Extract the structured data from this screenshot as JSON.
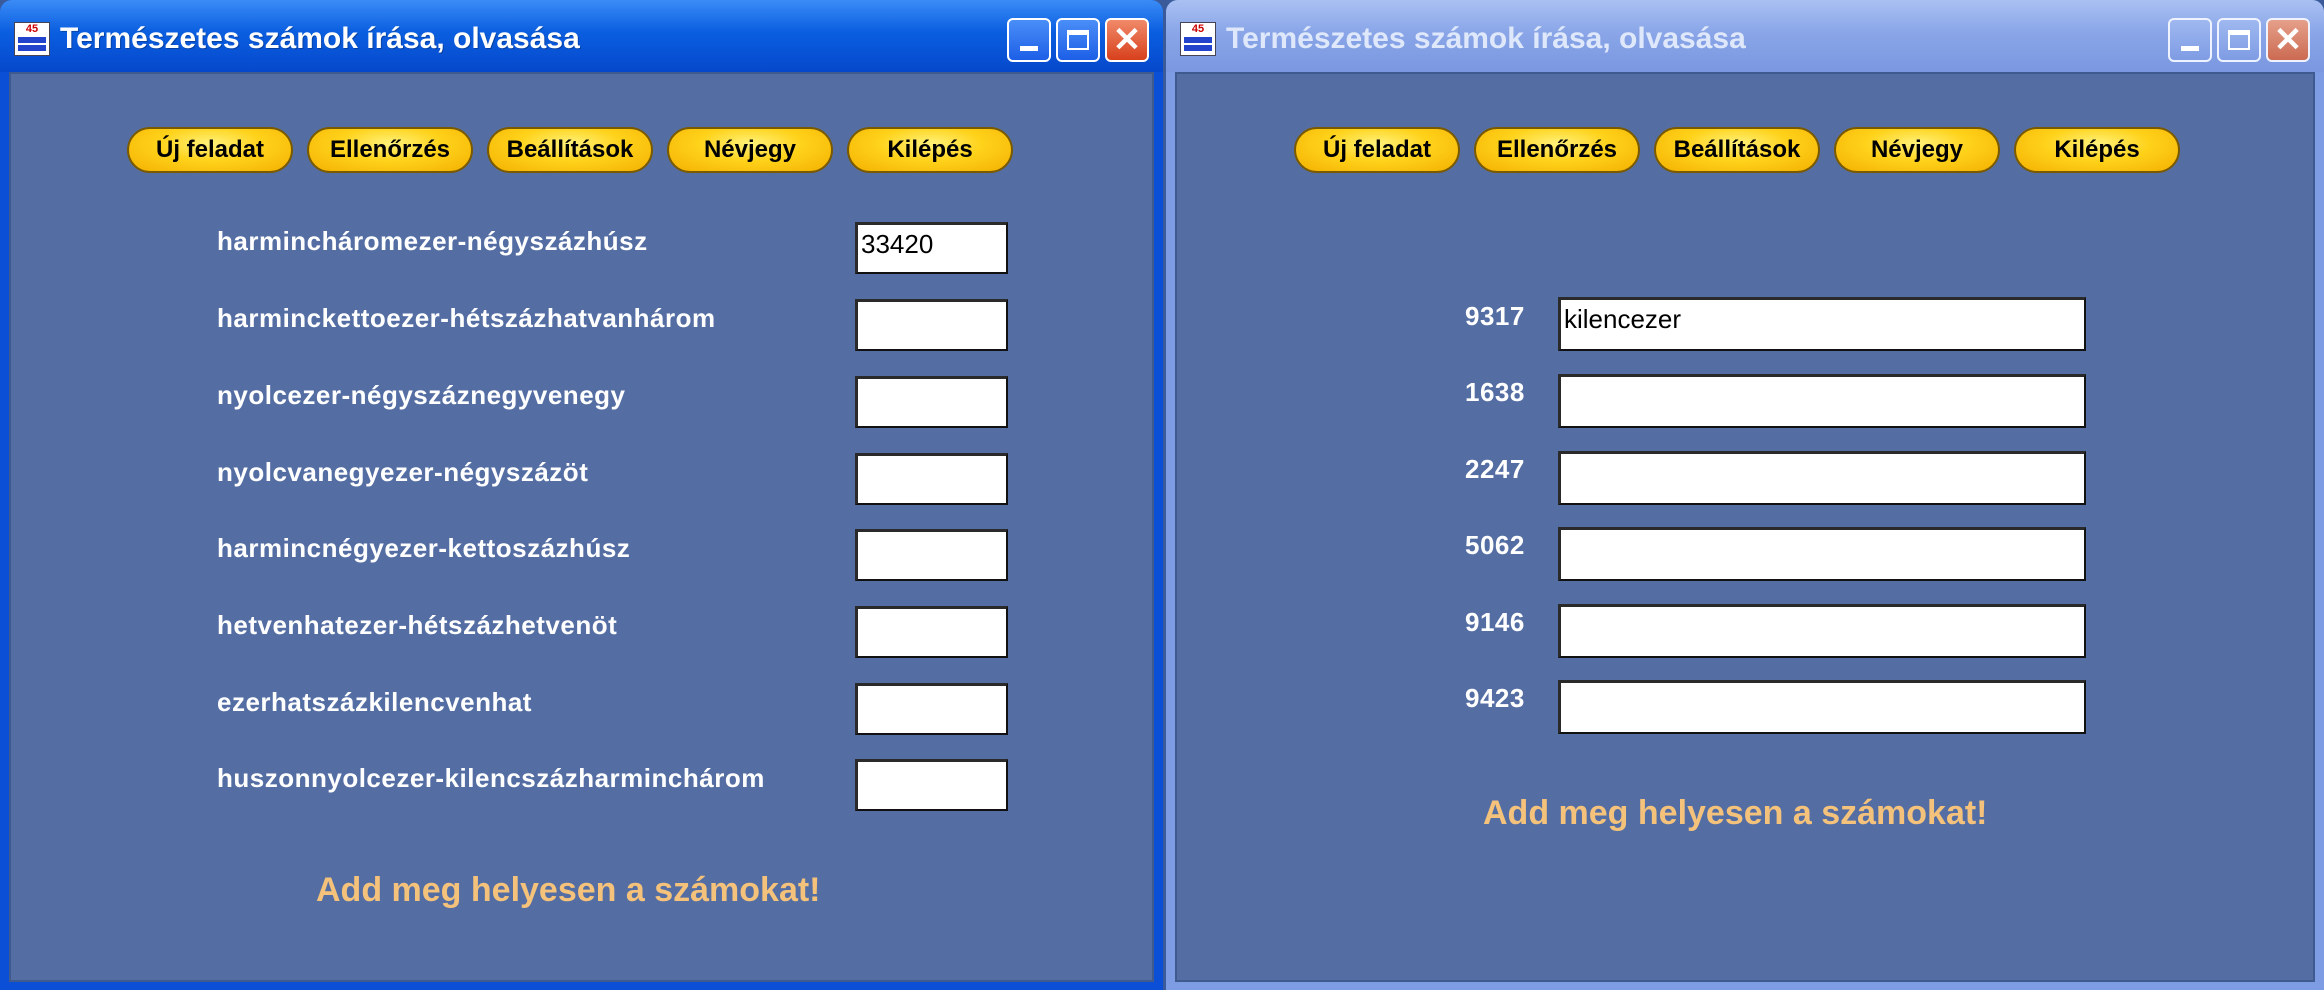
{
  "windows": [
    {
      "title": "Természetes számok írása, olvasása",
      "active": true,
      "buttons": [
        "Új feladat",
        "Ellenőrzés",
        "Beállítások",
        "Névjegy",
        "Kilépés"
      ],
      "rows": [
        {
          "label": "harminchárom​ezer-négyszázhúsz",
          "value": "33420"
        },
        {
          "label": "harminckettoezer-hétszázhatvanhárom",
          "value": ""
        },
        {
          "label": "nyolcezer-négyszáznegyvenegy",
          "value": ""
        },
        {
          "label": "nyolcvanegyezer-négyszázöt",
          "value": ""
        },
        {
          "label": "harmincnégyezer-kettoszázhúsz",
          "value": ""
        },
        {
          "label": "hetvenhatezer-hétszázhetvenöt",
          "value": ""
        },
        {
          "label": "ezerhatszázkilencvenhat",
          "value": ""
        },
        {
          "label": "huszonnyolcezer-kilencszázharminchárom",
          "value": ""
        }
      ],
      "message": "Add meg helyesen a számokat!"
    },
    {
      "title": "Természetes számok írása, olvasása",
      "active": false,
      "buttons": [
        "Új feladat",
        "Ellenőrzés",
        "Beállítások",
        "Névjegy",
        "Kilépés"
      ],
      "rows": [
        {
          "label": "9317",
          "value": "kilencezer"
        },
        {
          "label": "1638",
          "value": ""
        },
        {
          "label": "2247",
          "value": ""
        },
        {
          "label": "5062",
          "value": ""
        },
        {
          "label": "9146",
          "value": ""
        },
        {
          "label": "9423",
          "value": ""
        }
      ],
      "message": "Add meg helyesen a számokat!"
    }
  ],
  "icons": {
    "app": "app-icon",
    "minimize": "minimize-icon",
    "maximize": "maximize-icon",
    "close": "close-icon"
  },
  "colors": {
    "client_bg": "#546ea4",
    "message": "#f4c27a",
    "button_yellow": "#ffd21a",
    "titlebar_active": "#0a5ee0",
    "titlebar_inactive": "#8aa6e8"
  }
}
